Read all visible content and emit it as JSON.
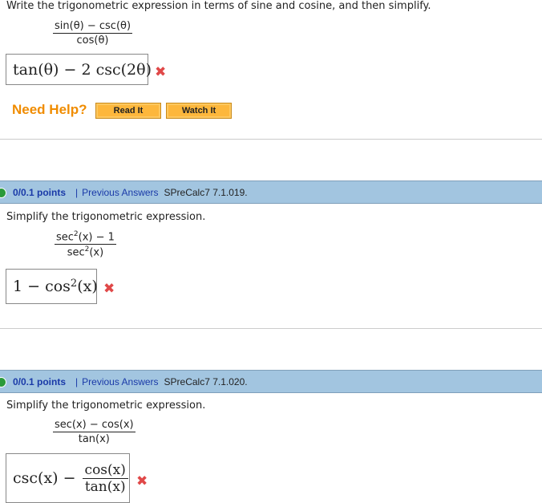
{
  "q1": {
    "prompt": "Write the trigonometric expression in terms of sine and cosine, and then simplify.",
    "numerator": "sin(θ) − csc(θ)",
    "denominator": "cos(θ)",
    "answer": "tan(θ) − 2 csc(2θ)",
    "result": "✖"
  },
  "help": {
    "label": "Need Help?",
    "read": "Read It",
    "watch": "Watch It"
  },
  "q2": {
    "points": "0/0.1 points",
    "sep": "|",
    "prev": "Previous Answers",
    "ref": "SPreCalc7 7.1.019.",
    "prompt": "Simplify the trigonometric expression.",
    "num_a": "sec",
    "num_b": "2",
    "num_c": "(x) − 1",
    "den_a": "sec",
    "den_b": "2",
    "den_c": "(x)",
    "ans_a": "1 − cos",
    "ans_b": "2",
    "ans_c": "(x)",
    "result": "✖"
  },
  "q3": {
    "points": "0/0.1 points",
    "sep": "|",
    "prev": "Previous Answers",
    "ref": "SPreCalc7 7.1.020.",
    "prompt": "Simplify the trigonometric expression.",
    "numerator": "sec(x) − cos(x)",
    "denominator": "tan(x)",
    "ans_a": "csc(x) −",
    "ans_num": "cos(x)",
    "ans_den": "tan(x)",
    "result": "✖"
  }
}
